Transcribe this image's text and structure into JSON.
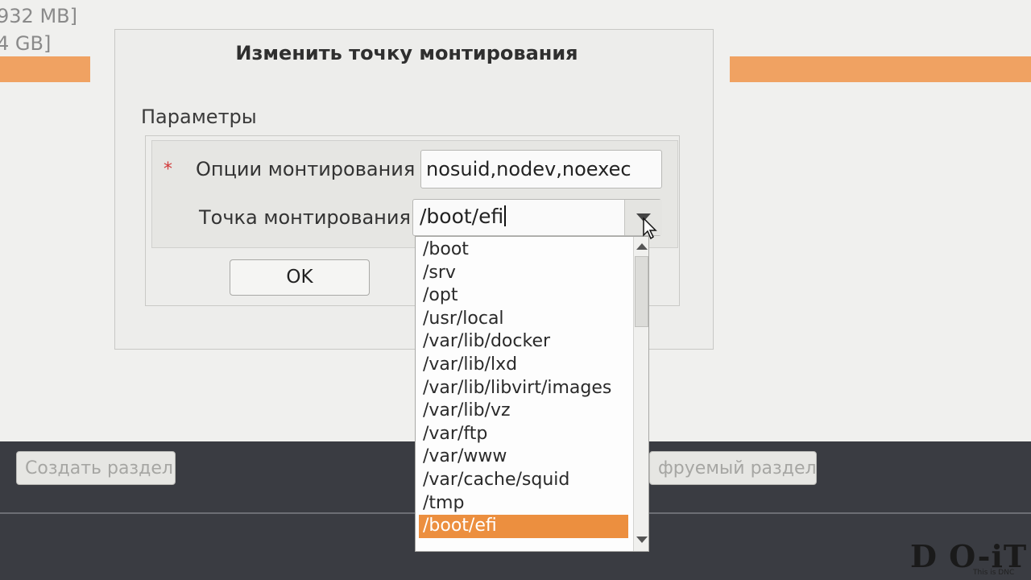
{
  "background": {
    "partition_sizes": [
      "932 MB]",
      "4 GB]"
    ],
    "bottom_buttons": {
      "create_partition": "Создать раздел",
      "encrypted_partition_partial": "фруемый раздел"
    }
  },
  "dialog": {
    "title": "Изменить точку монтирования",
    "section_label": "Параметры",
    "required_marker": "*",
    "mount_options": {
      "label": "Опции монтирования",
      "value": "nosuid,nodev,noexec"
    },
    "mount_point": {
      "label": "Точка монтирования",
      "value": "/boot/efi"
    },
    "ok_label": "OK"
  },
  "dropdown": {
    "items": [
      "/boot",
      "/srv",
      "/opt",
      "/usr/local",
      "/var/lib/docker",
      "/var/lib/lxd",
      "/var/lib/libvirt/images",
      "/var/lib/vz",
      "/var/ftp",
      "/var/www",
      "/var/cache/squid",
      "/tmp",
      "/boot/efi"
    ],
    "selected": "/boot/efi"
  },
  "watermark": {
    "logo_text": "D O-iT",
    "tagline": "This is DNC"
  },
  "colors": {
    "accent_orange": "#ec8f3f",
    "bar_orange": "#f0a262",
    "required_red": "#d23a3a",
    "dark_panel": "#3a3c42"
  },
  "icons": [
    "combo-arrow-down-icon",
    "scroll-up-icon",
    "scroll-down-icon",
    "mouse-pointer-icon",
    "required-asterisk-icon"
  ]
}
